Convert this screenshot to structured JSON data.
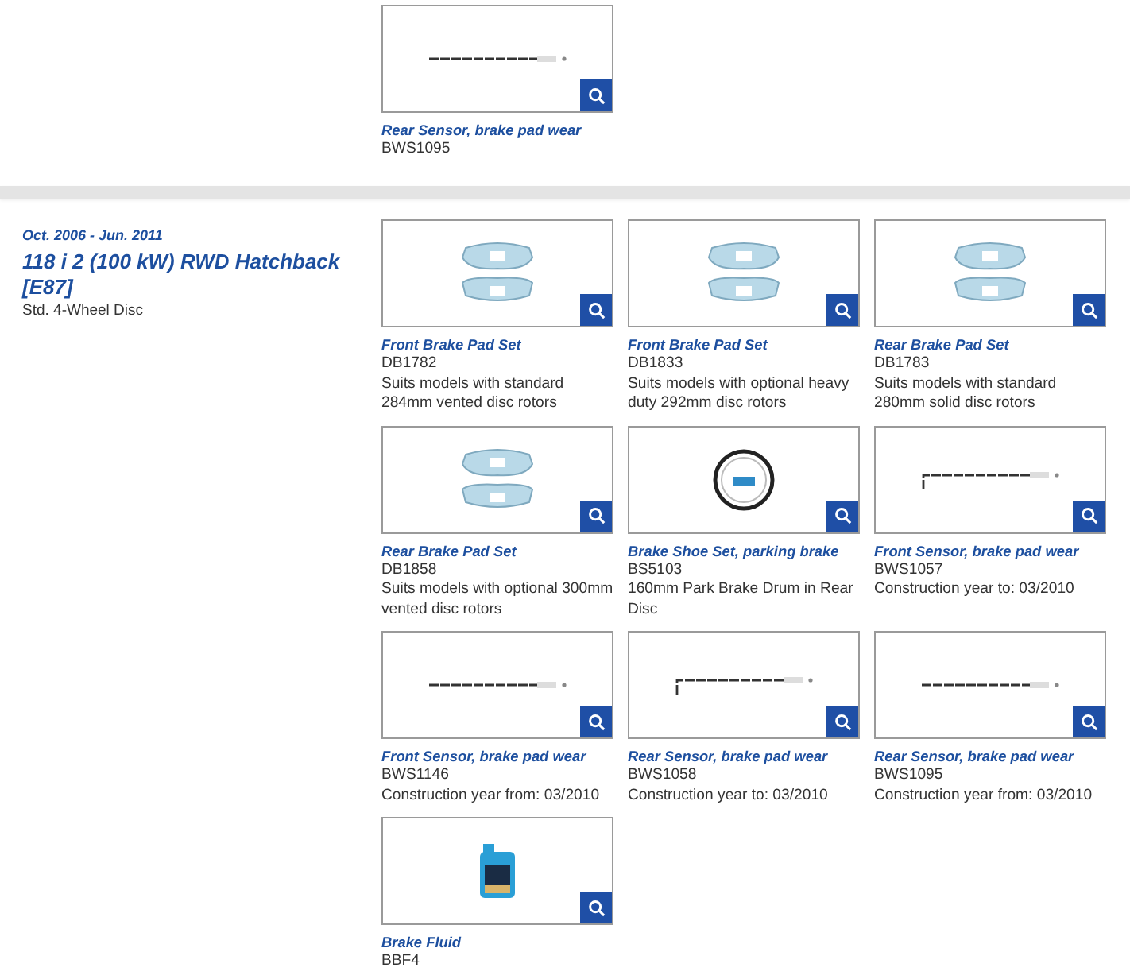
{
  "sections": [
    {
      "products": [
        {
          "kind": "sensor",
          "title": "Rear Sensor, brake pad wear",
          "code": "BWS1095"
        }
      ]
    },
    {
      "date": "Oct. 2006 - Jun. 2011",
      "model": "118 i 2 (100 kW) RWD Hatchback [E87]",
      "variant": "Std. 4-Wheel Disc",
      "products": [
        {
          "kind": "pads",
          "title": "Front Brake Pad Set",
          "code": "DB1782",
          "note": "Suits models with standard 284mm vented disc rotors"
        },
        {
          "kind": "pads",
          "title": "Front Brake Pad Set",
          "code": "DB1833",
          "note": "Suits models with optional heavy duty 292mm disc rotors"
        },
        {
          "kind": "pads",
          "title": "Rear Brake Pad Set",
          "code": "DB1783",
          "note": "Suits models with standard 280mm solid disc rotors"
        },
        {
          "kind": "pads",
          "title": "Rear Brake Pad Set",
          "code": "DB1858",
          "note": "Suits models with optional 300mm vented disc rotors"
        },
        {
          "kind": "shoe",
          "title": "Brake Shoe Set, parking brake",
          "code": "BS5103",
          "note": "160mm Park Brake Drum in Rear Disc"
        },
        {
          "kind": "sensor-bent",
          "title": "Front Sensor, brake pad wear",
          "code": "BWS1057",
          "note": "Construction year to: 03/2010"
        },
        {
          "kind": "sensor",
          "title": "Front Sensor, brake pad wear",
          "code": "BWS1146",
          "note": "Construction year from: 03/2010"
        },
        {
          "kind": "sensor-bent",
          "title": "Rear Sensor, brake pad wear",
          "code": "BWS1058",
          "note": "Construction year to: 03/2010"
        },
        {
          "kind": "sensor",
          "title": "Rear Sensor, brake pad wear",
          "code": "BWS1095",
          "note": "Construction year from: 03/2010"
        },
        {
          "kind": "fluid",
          "title": "Brake Fluid",
          "code": "BBF4"
        }
      ]
    }
  ]
}
